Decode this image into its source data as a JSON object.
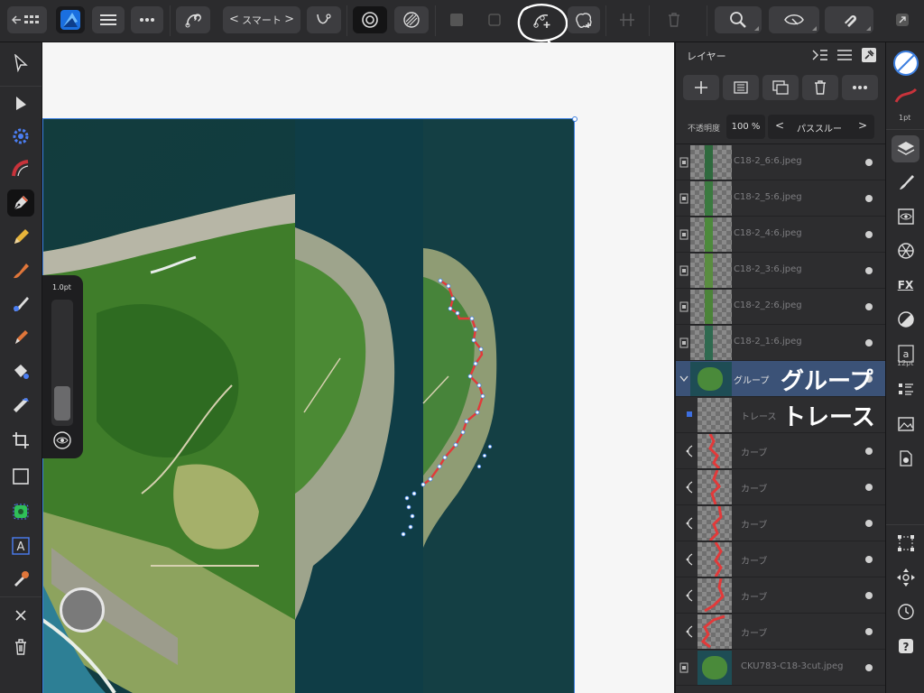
{
  "toolbar": {
    "persona_mode": "スマート",
    "prev_label": "<",
    "next_label": ">"
  },
  "brush": {
    "size_label": "1.0pt"
  },
  "layers_panel": {
    "title": "レイヤー",
    "opacity_label": "不透明度",
    "opacity_value": "100 %",
    "blend_mode": "パススルー",
    "layers": [
      {
        "name": "C18-2_6:6.jpeg"
      },
      {
        "name": "C18-2_5:6.jpeg"
      },
      {
        "name": "C18-2_4:6.jpeg"
      },
      {
        "name": "C18-2_3:6.jpeg"
      },
      {
        "name": "C18-2_2:6.jpeg"
      },
      {
        "name": "C18-2_1:6.jpeg"
      },
      {
        "name": "グループ",
        "annotation": "グループ"
      },
      {
        "name": "トレース",
        "annotation": "トレース"
      },
      {
        "name": "カーブ"
      },
      {
        "name": "カーブ"
      },
      {
        "name": "カーブ"
      },
      {
        "name": "カーブ"
      },
      {
        "name": "カーブ"
      },
      {
        "name": "カーブ"
      },
      {
        "name": "CKU783-C18-3cut.jpeg"
      }
    ]
  },
  "studio": {
    "stroke_width": "1pt",
    "text_size": "12pt"
  },
  "colors": {
    "selection": "#3b5277",
    "accent": "#3d7fe0",
    "curve_red": "#e23a3a"
  }
}
